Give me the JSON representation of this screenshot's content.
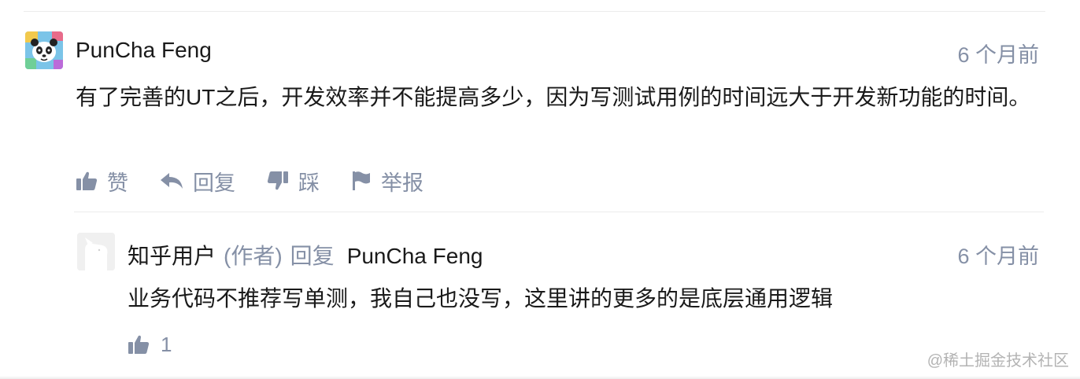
{
  "comment": {
    "author": "PunCha Feng",
    "time": "6 个月前",
    "text": "有了完善的UT之后，开发效率并不能提高多少，因为写测试用例的时间远大于开发新功能的时间。",
    "actions": {
      "like": "赞",
      "reply": "回复",
      "dislike": "踩",
      "report": "举报"
    }
  },
  "reply": {
    "author": "知乎用户",
    "role": "(作者)",
    "verb": "回复",
    "target": "PunCha Feng",
    "time": "6 个月前",
    "text": "业务代码不推荐写单测，我自己也没写，这里讲的更多的是底层通用逻辑",
    "like_count": "1"
  },
  "watermark": "@稀土掘金技术社区",
  "colors": {
    "muted": "#8590a6",
    "text": "#1a1a1a",
    "divider": "#ececec"
  },
  "icons": [
    "thumbs-up-icon",
    "reply-arrow-icon",
    "thumbs-down-icon",
    "flag-icon"
  ]
}
